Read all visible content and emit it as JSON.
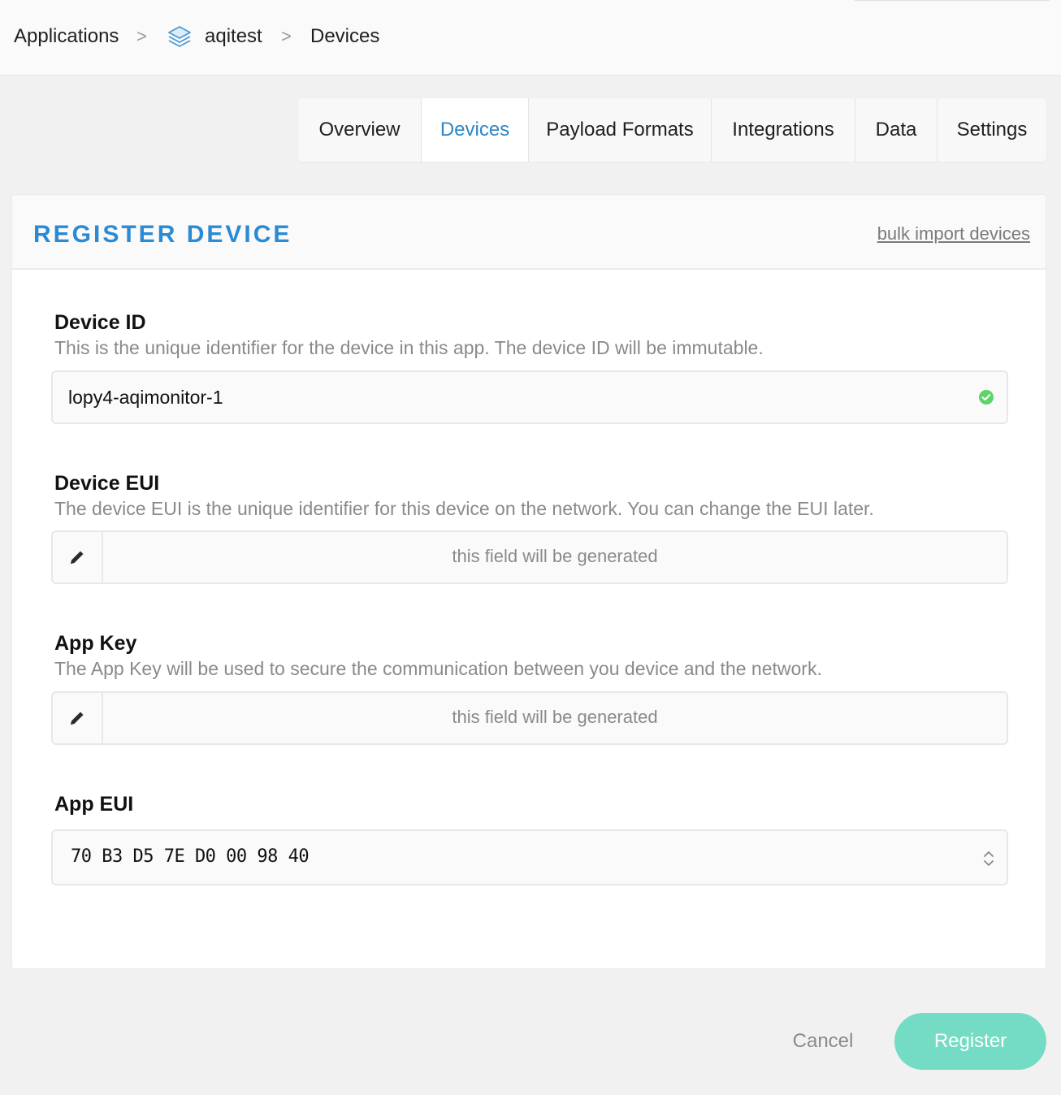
{
  "breadcrumb": {
    "applications": "Applications",
    "app_name": "aqitest",
    "current": "Devices",
    "separator": ">"
  },
  "tabs": [
    {
      "label": "Overview",
      "active": false
    },
    {
      "label": "Devices",
      "active": true
    },
    {
      "label": "Payload Formats",
      "active": false
    },
    {
      "label": "Integrations",
      "active": false
    },
    {
      "label": "Data",
      "active": false
    },
    {
      "label": "Settings",
      "active": false
    }
  ],
  "card": {
    "title": "REGISTER DEVICE",
    "bulk_link": "bulk import devices"
  },
  "fields": {
    "device_id": {
      "label": "Device ID",
      "description": "This is the unique identifier for the device in this app. The device ID will be immutable.",
      "value": "lopy4-aqimonitor-1",
      "valid": true
    },
    "device_eui": {
      "label": "Device EUI",
      "description": "The device EUI is the unique identifier for this device on the network. You can change the EUI later.",
      "placeholder": "this field will be generated"
    },
    "app_key": {
      "label": "App Key",
      "description": "The App Key will be used to secure the communication between you device and the network.",
      "placeholder": "this field will be generated"
    },
    "app_eui": {
      "label": "App EUI",
      "value": "70 B3 D5 7E D0 00 98 40"
    }
  },
  "actions": {
    "cancel": "Cancel",
    "register": "Register"
  },
  "icons": {
    "app": "layers-icon",
    "valid": "check-circle-icon",
    "edit": "pencil-icon",
    "select": "up-down-chevron-icon"
  },
  "colors": {
    "accent": "#2a8ad4",
    "active_tab": "#2f86c8",
    "register_button": "#74dcc4",
    "valid_check": "#5fd36a"
  }
}
